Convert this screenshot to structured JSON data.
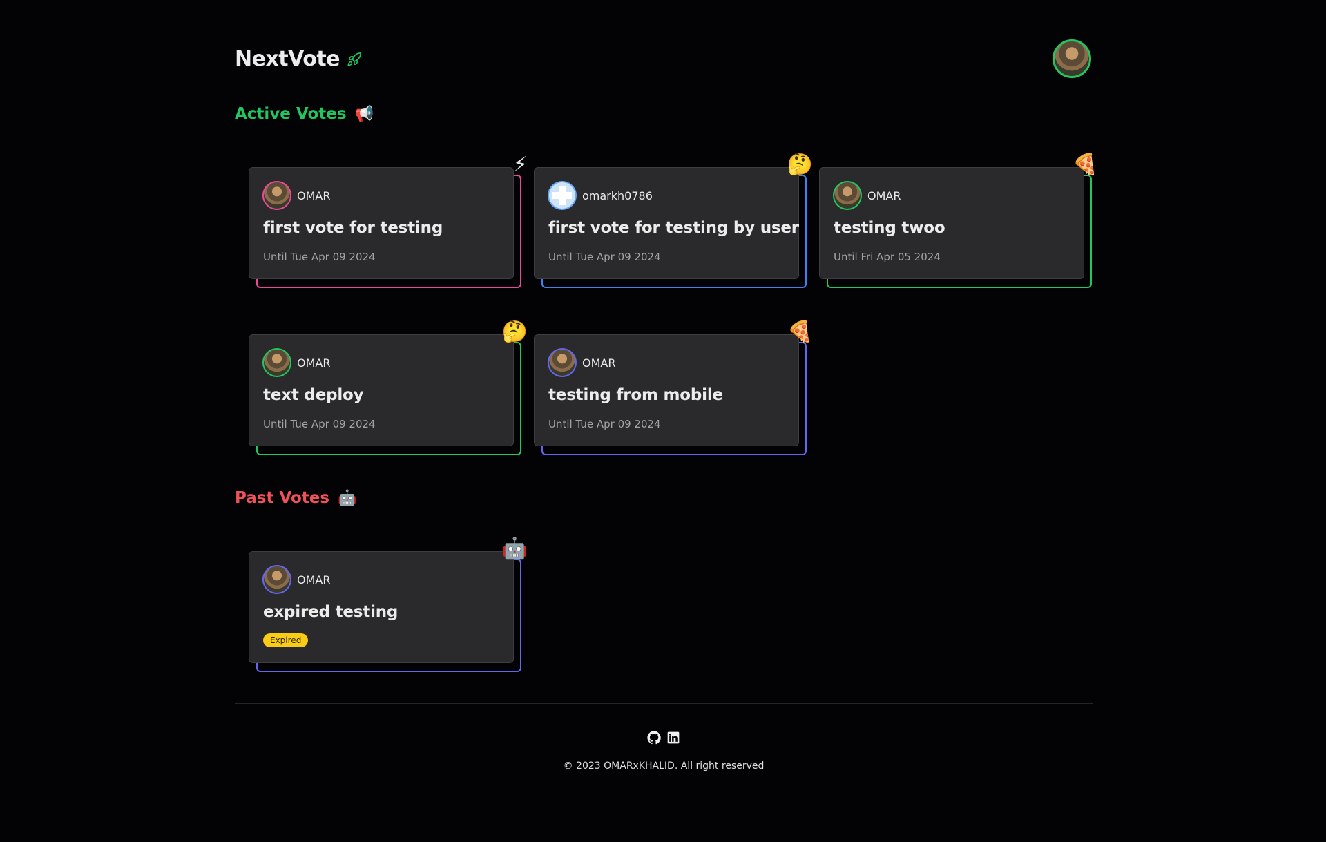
{
  "header": {
    "brand": "NextVote",
    "brand_icon": "rocket-icon"
  },
  "active_section": {
    "title": "Active Votes",
    "emoji": "📢"
  },
  "past_section": {
    "title": "Past Votes",
    "emoji": "🤖"
  },
  "active_votes": [
    {
      "author": "OMAR",
      "title": "first vote for testing",
      "date": "Until Tue Apr 09 2024",
      "emoji": "⚡",
      "accent": "#ec4899"
    },
    {
      "author": "omarkh0786",
      "title": "first vote for testing by user",
      "date": "Until Tue Apr 09 2024",
      "emoji": "🤔",
      "accent": "#3b82f6"
    },
    {
      "author": "OMAR",
      "title": "testing twoo",
      "date": "Until Fri Apr 05 2024",
      "emoji": "🍕",
      "accent": "#22c55e"
    },
    {
      "author": "OMAR",
      "title": "text deploy",
      "date": "Until Tue Apr 09 2024",
      "emoji": "🤔",
      "accent": "#22c55e"
    },
    {
      "author": "OMAR",
      "title": "testing from mobile",
      "date": "Until Tue Apr 09 2024",
      "emoji": "🍕",
      "accent": "#6366f1"
    }
  ],
  "past_votes": [
    {
      "author": "OMAR",
      "title": "expired testing",
      "badge": "Expired",
      "emoji": "🤖",
      "accent": "#6366f1"
    }
  ],
  "footer": {
    "copyright": "© 2023 OMARxKHALID. All right reserved"
  }
}
